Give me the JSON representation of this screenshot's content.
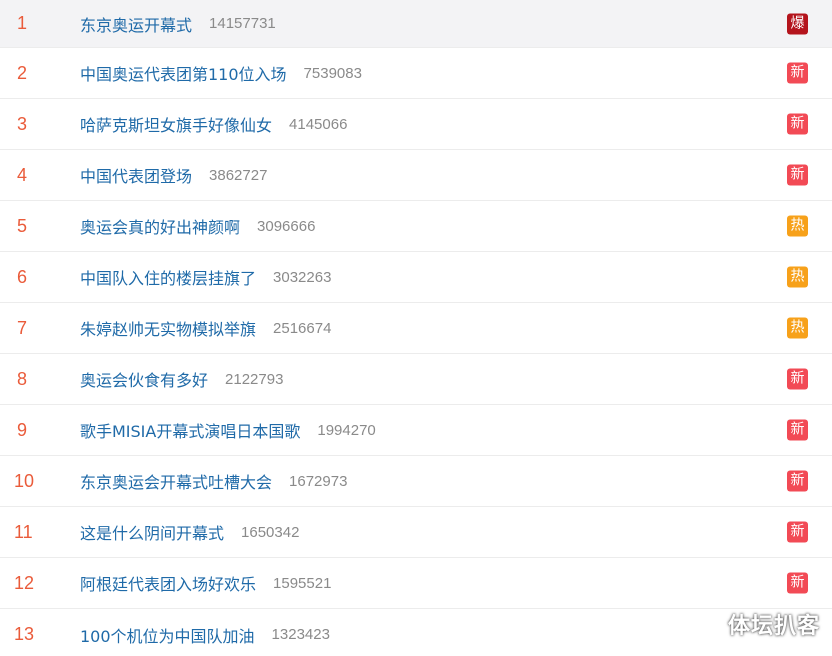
{
  "rows": [
    {
      "rank": "1",
      "title": "东京奥运开幕式",
      "count": "14157731",
      "badge": "爆",
      "badge_type": "bao"
    },
    {
      "rank": "2",
      "title": "中国奥运代表团第110位入场",
      "count": "7539083",
      "badge": "新",
      "badge_type": "xin"
    },
    {
      "rank": "3",
      "title": "哈萨克斯坦女旗手好像仙女",
      "count": "4145066",
      "badge": "新",
      "badge_type": "xin"
    },
    {
      "rank": "4",
      "title": "中国代表团登场",
      "count": "3862727",
      "badge": "新",
      "badge_type": "xin"
    },
    {
      "rank": "5",
      "title": "奥运会真的好出神颜啊",
      "count": "3096666",
      "badge": "热",
      "badge_type": "re"
    },
    {
      "rank": "6",
      "title": "中国队入住的楼层挂旗了",
      "count": "3032263",
      "badge": "热",
      "badge_type": "re"
    },
    {
      "rank": "7",
      "title": "朱婷赵帅无实物模拟举旗",
      "count": "2516674",
      "badge": "热",
      "badge_type": "re"
    },
    {
      "rank": "8",
      "title": "奥运会伙食有多好",
      "count": "2122793",
      "badge": "新",
      "badge_type": "xin"
    },
    {
      "rank": "9",
      "title": "歌手MISIA开幕式演唱日本国歌",
      "count": "1994270",
      "badge": "新",
      "badge_type": "xin"
    },
    {
      "rank": "10",
      "title": "东京奥运会开幕式吐槽大会",
      "count": "1672973",
      "badge": "新",
      "badge_type": "xin"
    },
    {
      "rank": "11",
      "title": "这是什么阴间开幕式",
      "count": "1650342",
      "badge": "新",
      "badge_type": "xin"
    },
    {
      "rank": "12",
      "title": "阿根廷代表团入场好欢乐",
      "count": "1595521",
      "badge": "新",
      "badge_type": "xin"
    },
    {
      "rank": "13",
      "title": "100个机位为中国队加油",
      "count": "1323423",
      "badge": "",
      "badge_type": ""
    }
  ],
  "watermark": "体坛扒客",
  "colors": {
    "rank": "#ea5b3a",
    "title": "#1f6aa8",
    "count": "#8a8a8a",
    "badge_bao": "#b4141c",
    "badge_xin": "#f24a55",
    "badge_re": "#f7a11a"
  }
}
